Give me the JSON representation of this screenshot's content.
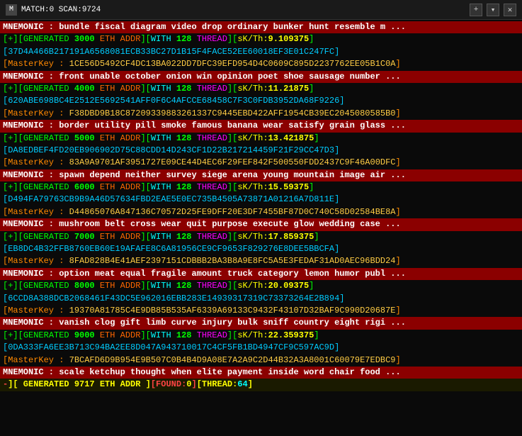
{
  "titleBar": {
    "icon": "M",
    "title": "MATCH:0 SCAN:9724",
    "closeBtn": "✕",
    "addBtn": "+",
    "dropBtn": "▾"
  },
  "lines": [
    {
      "type": "mnemonic",
      "text": "MNEMONIC : bundle fiscal diagram video drop ordinary bunker hunt resemble m ..."
    },
    {
      "type": "generated",
      "num": "3000",
      "thread": "128",
      "sk": "9.109375"
    },
    {
      "type": "addr",
      "hex": "37D4A466B217191A6568081ECB33BC27D1B15F4FACE52EE60018EF3E01C247FC"
    },
    {
      "type": "masterkey",
      "label": "MasterKey",
      "val": "1CE56D5492CF4DC13BA022DD7DFC39EFD954D4C0609C895D2237762EE05B1C0A"
    },
    {
      "type": "mnemonic",
      "text": "MNEMONIC : front unable october onion win opinion poet shoe sausage number ..."
    },
    {
      "type": "generated",
      "num": "4000",
      "thread": "128",
      "sk": "11.21875"
    },
    {
      "type": "addr",
      "hex": "620ABE698BC4E2512E5692541AFF0F6C4AFCCE68458C7F3C0FDB3952DA68F9226"
    },
    {
      "type": "masterkey",
      "label": "MasterKey",
      "val": "F38DBD9B18C87209339883261337C9445EBD422AFF1954CB39EC2045080585B0"
    },
    {
      "type": "mnemonic",
      "text": "MNEMONIC : border utility pill smoke famous banana wear satisfy grain glass ..."
    },
    {
      "type": "generated",
      "num": "5000",
      "thread": "128",
      "sk": "13.421875"
    },
    {
      "type": "addr",
      "hex": "DA8EDBEF4FD20EB906902D75C88CDD14D243CF1D22B217214459F21F29CC47D3"
    },
    {
      "type": "masterkey",
      "label": "MasterKey",
      "val": "83A9A9701AF3951727E09CE44D4EC6F29FEF842F500550FDD2437C9F46A00DFC"
    },
    {
      "type": "mnemonic",
      "text": "MNEMONIC : spawn depend neither survey siege arena young mountain image air ..."
    },
    {
      "type": "generated",
      "num": "6000",
      "thread": "128",
      "sk": "15.59375"
    },
    {
      "type": "addr",
      "hex": "D494FA79763CB9B9A46D57634FBD2EAE5E0EC735B4505A73871A01216A7D811E"
    },
    {
      "type": "masterkey",
      "label": "MasterKey",
      "val": "D44865076A847136C70572D25FE9DFF20E3DF7455BF87D0C740C58D02584BE8A"
    },
    {
      "type": "mnemonic",
      "text": "MNEMONIC : mushroom belt cross wear quit purpose execute glow wedding case ..."
    },
    {
      "type": "generated",
      "num": "7000",
      "thread": "128",
      "sk": "17.859375"
    },
    {
      "type": "addr",
      "hex": "EB8DC4B32FFB8760EB60E19AFAFE8C6A81956CE9CF9653F829276E8DEE5BBCFA"
    },
    {
      "type": "masterkey",
      "label": "MasterKey",
      "val": "8FAD828B4E41AEF2397151CDBBB2BA3B8A9E8FC5A5E3FEDAF31AD0AEC96BDD24"
    },
    {
      "type": "mnemonic",
      "text": "MNEMONIC : option meat equal fragile amount truck category lemon humor publ ..."
    },
    {
      "type": "generated",
      "num": "8000",
      "thread": "128",
      "sk": "20.09375"
    },
    {
      "type": "addr",
      "hex": "6CCD8A388DCB2068461F43DC5E962016EBB283E14939317319C73373264E2B894"
    },
    {
      "type": "masterkey",
      "label": "MasterKey",
      "val": "19370A81785C4E9DB85B535AF6339A69133C9432F43107D32BAF9C990D20687E"
    },
    {
      "type": "mnemonic",
      "text": "MNEMONIC : vanish clog gift limb curve injury bulk sniff country eight rigi ..."
    },
    {
      "type": "generated",
      "num": "9000",
      "thread": "128",
      "sk": "22.359375"
    },
    {
      "type": "addr",
      "hex": "0DA333FA6EE3B713C94BA2EE8D047A943710017C4CF5FB1BD4947CF9C597AC9D"
    },
    {
      "type": "masterkey",
      "label": "MasterKey",
      "val": "7BCAFD6D9B954E9B507C0B4B4D9A08E7A2A9C2D44B32A3A8001C60079E7EDBC9"
    },
    {
      "type": "mnemonic",
      "text": "MNEMONIC : scale ketchup thought when elite payment inside word chair food ..."
    },
    {
      "type": "status",
      "scan": "9717",
      "found": "0",
      "thread": "64"
    }
  ]
}
